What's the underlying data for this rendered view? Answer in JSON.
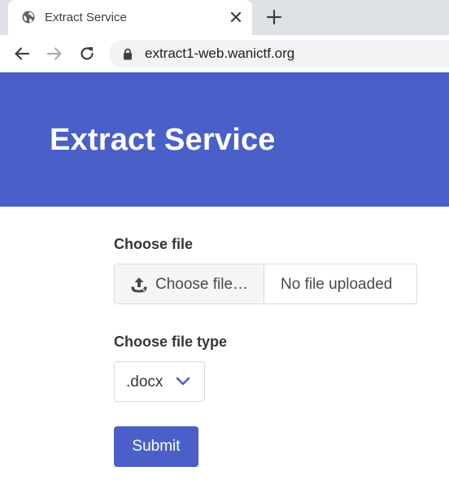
{
  "browser": {
    "tab_title": "Extract Service",
    "url": "extract1-web.wanictf.org",
    "icons": {
      "favicon": "globe-icon",
      "tab_close": "close-icon",
      "new_tab": "plus-icon",
      "back": "arrow-left-icon",
      "forward": "arrow-right-icon",
      "reload": "reload-icon",
      "lock": "lock-icon"
    }
  },
  "header": {
    "title": "Extract Service",
    "background_color": "#4a60c8"
  },
  "form": {
    "file_label": "Choose file",
    "file_button_label": "Choose file…",
    "file_name": "No file uploaded",
    "file_type_label": "Choose file type",
    "file_type_value": ".docx",
    "submit_label": "Submit",
    "icons": {
      "upload": "upload-icon",
      "dropdown": "chevron-down-icon"
    },
    "accent_color": "#4a60c8"
  }
}
